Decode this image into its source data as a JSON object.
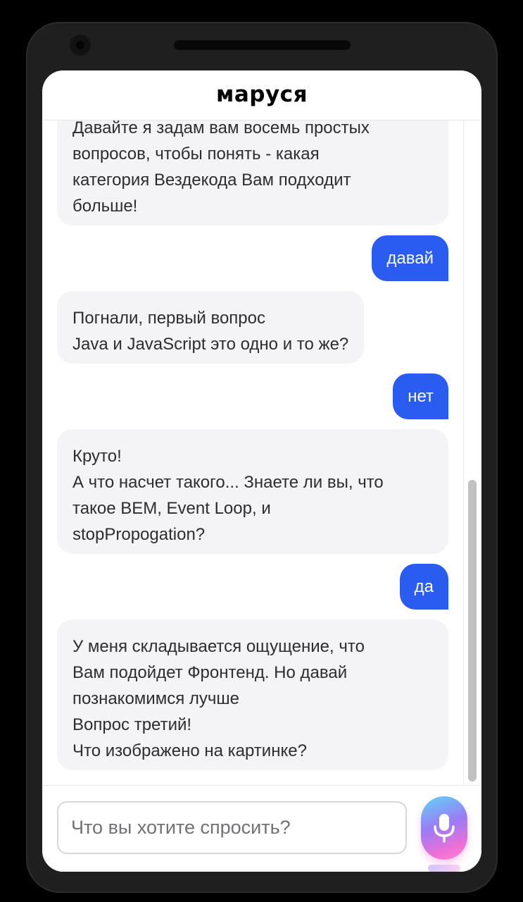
{
  "header": {
    "logo_text": "маруся"
  },
  "chat": {
    "messages": [
      {
        "from": "bot",
        "lines": [
          "Давайте я задам вам восемь простых",
          "вопросов, чтобы понять - какая",
          "категория Вездекода Вам подходит",
          "больше!"
        ]
      },
      {
        "from": "user",
        "text": "давай"
      },
      {
        "from": "bot",
        "lines": [
          "Погнали, первый вопрос",
          "Java и JavaScript это одно и то же?"
        ]
      },
      {
        "from": "user",
        "text": "нет"
      },
      {
        "from": "bot",
        "lines": [
          "Круто!",
          "А что насчет такого... Знаете ли вы, что",
          "такое BEM, Event Loop, и",
          "stopPropogation?"
        ]
      },
      {
        "from": "user",
        "text": "да"
      },
      {
        "from": "bot",
        "lines": [
          "У меня складывается ощущение, что",
          "Вам подойдет Фронтенд. Но давай",
          "познакомимся лучше",
          "Вопрос третий!",
          "Что изображено на картинке?"
        ]
      }
    ]
  },
  "footer": {
    "input_placeholder": "Что вы хотите спросить?",
    "input_value": "",
    "mic_icon": "microphone-icon"
  },
  "colors": {
    "user_bubble": "#2b5cf0",
    "bot_bubble": "#f4f4f6",
    "text": "#2c2d2e"
  }
}
